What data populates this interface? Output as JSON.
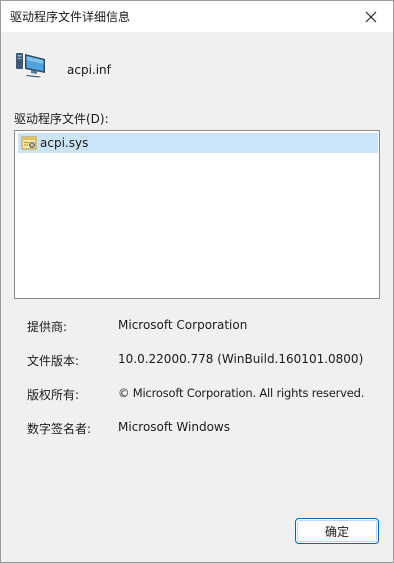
{
  "window": {
    "title": "驱动程序文件详细信息",
    "close_icon": "close-icon"
  },
  "header": {
    "icon": "computer-monitor-icon",
    "file_name": "acpi.inf"
  },
  "file_list": {
    "label": "驱动程序文件(D):",
    "items": [
      {
        "label": "acpi.sys",
        "icon": "system-file-icon",
        "selected": true
      }
    ]
  },
  "properties": {
    "provider_label": "提供商:",
    "provider_value": "Microsoft Corporation",
    "version_label": "文件版本:",
    "version_value": "10.0.22000.778 (WinBuild.160101.0800)",
    "copyright_label": "版权所有:",
    "copyright_value": "© Microsoft Corporation. All rights reserved.",
    "signer_label": "数字签名者:",
    "signer_value": "Microsoft Windows"
  },
  "buttons": {
    "ok_label": "确定"
  },
  "colors": {
    "selection": "#cce4f7",
    "accent": "#0067c0"
  }
}
